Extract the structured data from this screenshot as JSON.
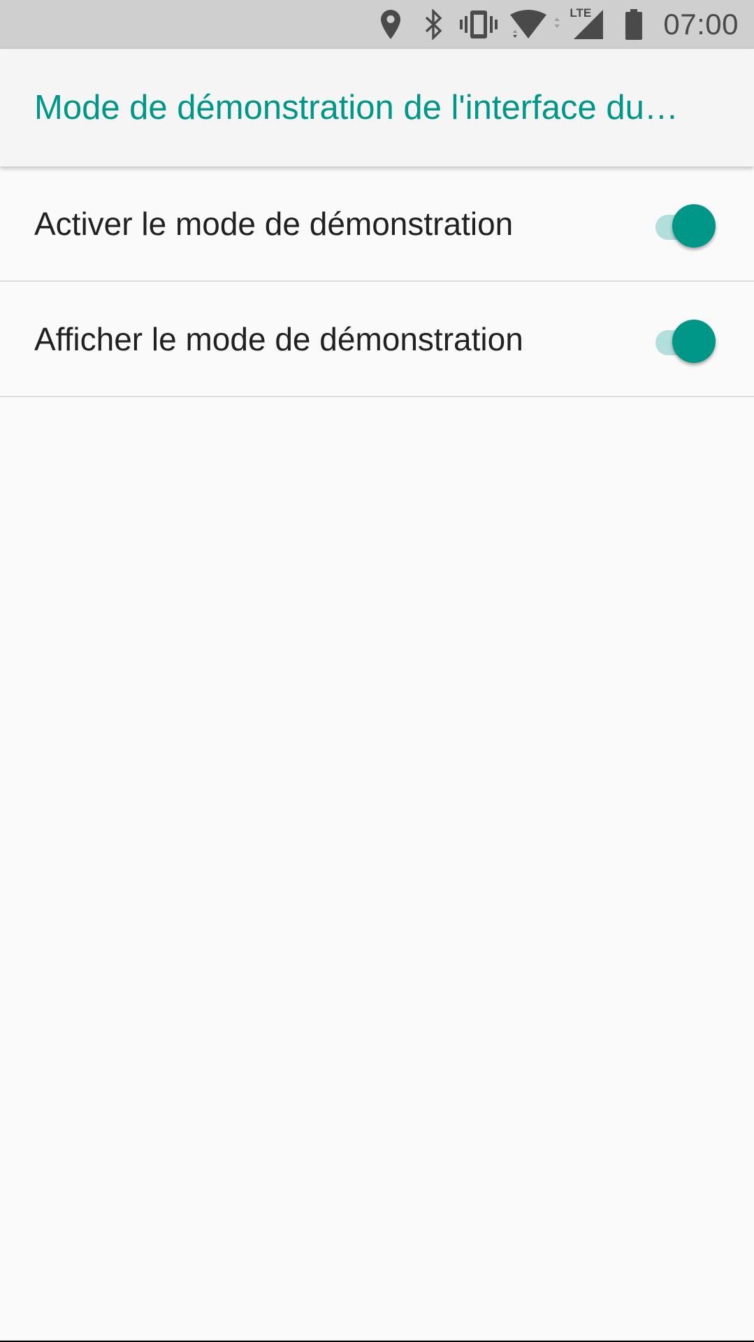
{
  "status_bar": {
    "time": "07:00",
    "network_label": "LTE",
    "icons": [
      "location-icon",
      "bluetooth-icon",
      "vibrate-icon",
      "wifi-icon",
      "cell-signal-icon",
      "battery-icon"
    ]
  },
  "app_bar": {
    "title": "Mode de démonstration de l'interface du…"
  },
  "settings": {
    "items": [
      {
        "label": "Activer le mode de démonstration",
        "checked": true
      },
      {
        "label": "Afficher le mode de démonstration",
        "checked": true
      }
    ]
  },
  "colors": {
    "accent": "#009688",
    "accent_track": "#b2dfdb",
    "status_bar_bg": "#cfcfcf",
    "app_bar_bg": "#f5f5f5",
    "background": "#fafafa"
  }
}
